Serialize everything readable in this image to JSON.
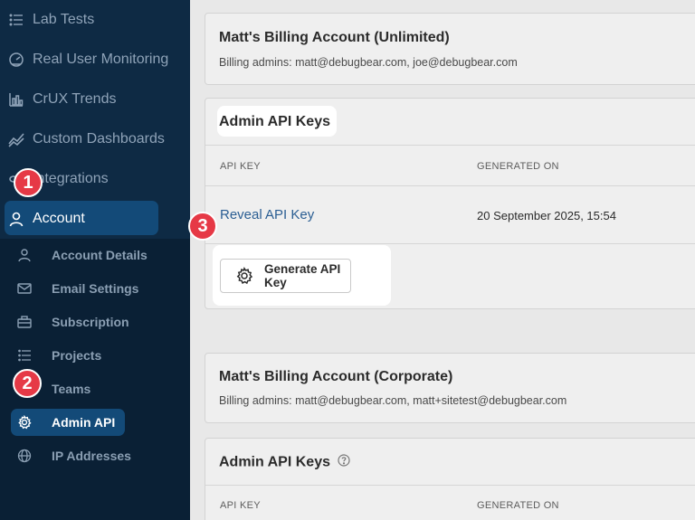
{
  "sidebar": {
    "items": [
      {
        "label": "Lab Tests",
        "icon": "list-icon"
      },
      {
        "label": "Real User Monitoring",
        "icon": "gauge-icon"
      },
      {
        "label": "CrUX Trends",
        "icon": "bar-chart-icon"
      },
      {
        "label": "Custom Dashboards",
        "icon": "trend-icon"
      },
      {
        "label": "Integrations",
        "icon": "link-icon"
      },
      {
        "label": "Account",
        "icon": "user-icon"
      }
    ],
    "sub_items": [
      {
        "label": "Account Details",
        "icon": "user-icon"
      },
      {
        "label": "Email Settings",
        "icon": "mail-icon"
      },
      {
        "label": "Subscription",
        "icon": "briefcase-icon"
      },
      {
        "label": "Projects",
        "icon": "list-icon"
      },
      {
        "label": "Teams",
        "icon": "users-icon"
      },
      {
        "label": "Admin API",
        "icon": "gear-icon"
      },
      {
        "label": "IP Addresses",
        "icon": "globe-icon"
      }
    ]
  },
  "badges": {
    "one": "1",
    "two": "2",
    "three": "3"
  },
  "accounts": [
    {
      "title": "Matt's Billing Account (Unlimited)",
      "admins": "Billing admins: matt@debugbear.com, joe@debugbear.com"
    },
    {
      "title": "Matt's Billing Account (Corporate)",
      "admins": "Billing admins: matt@debugbear.com, matt+sitetest@debugbear.com"
    }
  ],
  "keys_panel": {
    "title": "Admin API Keys",
    "col_key": "API KEY",
    "col_generated": "GENERATED ON",
    "reveal_link": "Reveal API Key",
    "generated_on": "20 September 2025, 15:54",
    "generate_button": "Generate API Key"
  },
  "keys_panel_2": {
    "title": "Admin API Keys",
    "col_key": "API KEY",
    "col_generated": "GENERATED ON"
  },
  "colors": {
    "sidebar_bg": "#0e2a44",
    "active_pill": "#134a78",
    "badge": "#e63946",
    "link": "#2b5e93"
  }
}
